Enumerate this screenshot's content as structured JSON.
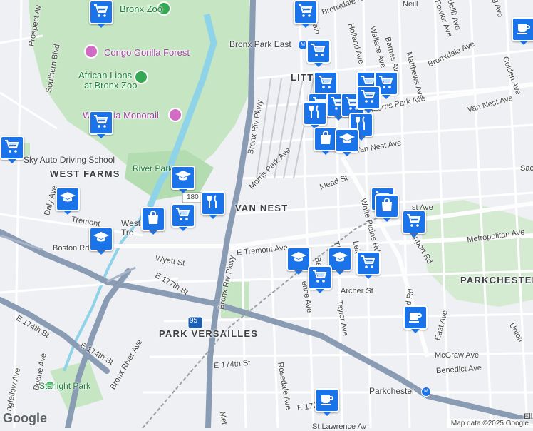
{
  "map": {
    "neighborhoods": {
      "van_nest": "VAN NEST",
      "west_farms": "WEST FARMS",
      "park_versailles": "PARK VERSAILLES",
      "parkchester_hood": "PARKCHESTER",
      "little_italy": "LITT"
    },
    "places": {
      "bronx_zoo": "Bronx Zoo",
      "congo": "Congo Gorilla Forest",
      "lions_1": "African Lions",
      "lions_2": "at Bronx Zoo",
      "monorail": "Wild Asia Monorail",
      "sky_auto": "Sky Auto Driving School",
      "river_park": "River Park",
      "starlight": "Starlight Park",
      "bronx_park_east": "Bronx Park East",
      "parkchester_stn": "Parkchester",
      "st_lawrence": "St Lawrence Av",
      "west_farms_sq_1": "West",
      "west_farms_sq_2": "Tre"
    },
    "roads": {
      "bronx_riv_pkwy_1": "Bronx Riv Pkwy",
      "bronx_riv_pkwy_2": "Bronx Riv Pkwy",
      "morris_park_1": "Morris Park Ave",
      "morris_park_2": "Morris Park Ave",
      "van_nest_ave": "Van Nest Ave",
      "van_nest_ave_2": "Van Nest Ave",
      "e_tremont": "E Tremont Ave",
      "tremont_w": "Tremont",
      "boston_rd": "Boston Rd",
      "wyatt": "Wyatt St",
      "e177": "E 177th St",
      "e174_w": "E 174th St",
      "e174_e": "E 174th St",
      "e174_s": "E 174th St",
      "bronx_river_ave": "Bronx River Ave",
      "boone": "Boone Ave",
      "longfellow": "ngfellow Ave",
      "rosedale": "Rosedale Ave",
      "white_plains": "White Plains Rd",
      "unionport": "Unionport Rd",
      "metropolitan": "Metropolitan Ave",
      "mcgraw": "McGraw Ave",
      "benedict": "Benedict Ave",
      "taylor": "Taylor Ave",
      "archer": "Archer St",
      "mead": "Mead St",
      "southern": "Southern Blvd",
      "prospect": "Prospect Av",
      "daly": "Daly Ave",
      "bronxdale": "Bronxdale Ave",
      "holland": "Holland Ave",
      "wallace": "Wallace Ave",
      "barnes": "Barnes Av",
      "matthews": "Matthews Ave",
      "colden": "Colden Ave",
      "fowler": "Fowler Ave",
      "east_ave": "East Ave",
      "beach": "Beach",
      "thi": "Thi",
      "leland": "Leland",
      "union_e": "Union",
      "sac": "Sac",
      "clarence": "ence Ave",
      "ward": "Ward Rd",
      "e172": "E 172n",
      "met": "Met",
      "plain_top": "Plain",
      "bronxdale_top": "Bronxdale Ave",
      "neill": "Neill",
      "radcliff": "dcliff Ave",
      "g_ave": "g Ave",
      "i95": "95",
      "i180": "180",
      "ell": "Ell",
      "st_ave": "st Ave"
    },
    "attribution": "Map data ©2025 Google",
    "logo": "Google",
    "colors": {
      "poi": "#1a73e8",
      "park": "#c6e6c3",
      "water": "#8fd3e8",
      "highway": "#8a9bb4"
    }
  },
  "markers": [
    {
      "type": "coffee-icon"
    },
    {
      "type": "shopping-cart-icon"
    },
    {
      "type": "restaurant-icon"
    },
    {
      "type": "school-icon"
    },
    {
      "type": "shopping-bag-icon"
    }
  ]
}
